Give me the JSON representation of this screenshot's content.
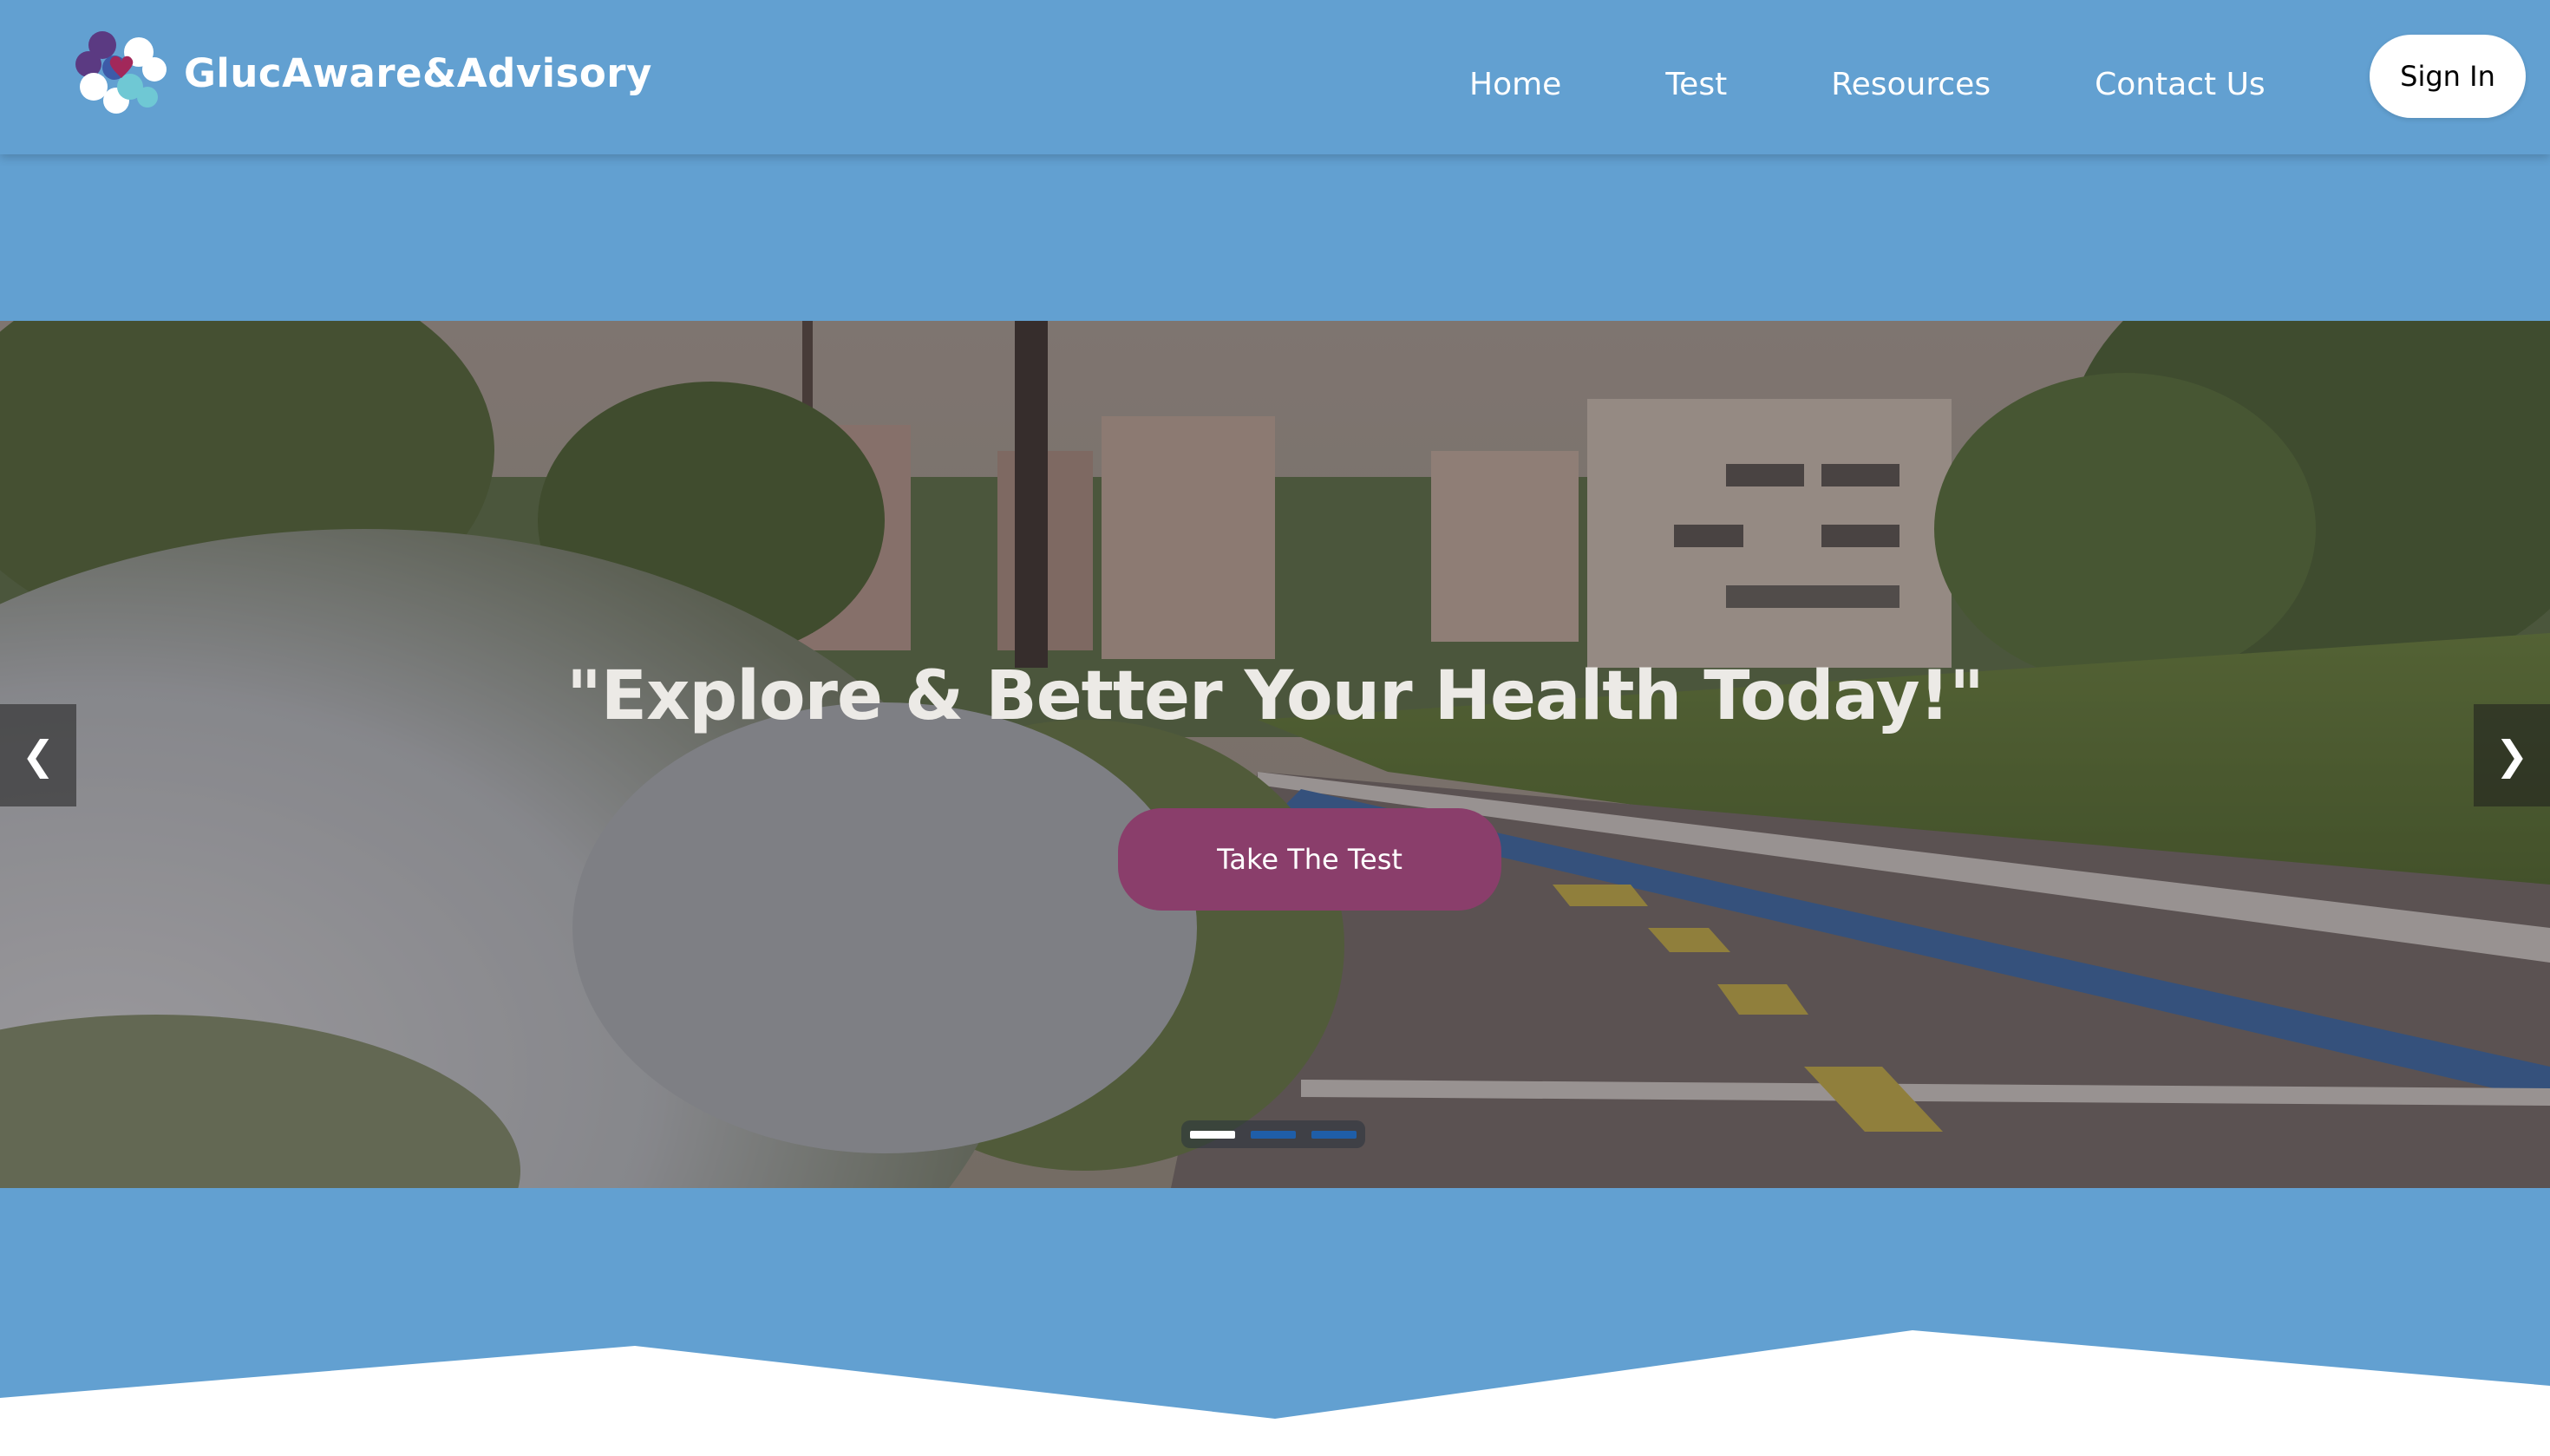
{
  "brand": {
    "name": "GlucAware&Advisory",
    "logo_icon": "heart-puzzle-cloud-logo",
    "colors": {
      "primary": "#62a0d1",
      "accent": "#8a3e6b",
      "logo_purple": "#5b3a82",
      "logo_teal": "#6fc8d4",
      "logo_heart": "#a2285a"
    }
  },
  "nav": {
    "items": [
      {
        "label": "Home",
        "active": true
      },
      {
        "label": "Test",
        "active": false
      },
      {
        "label": "Resources",
        "active": false
      },
      {
        "label": "Contact Us",
        "active": false
      }
    ],
    "sign_in_label": "Sign In"
  },
  "hero": {
    "title": "\"Explore & Better Your Health Today!\"",
    "cta_label": "Take The Test",
    "prev_icon": "chevron-left-icon",
    "next_icon": "chevron-right-icon",
    "prev_glyph": "❮",
    "next_glyph": "❯",
    "slides_count": 3,
    "active_slide": 1
  }
}
